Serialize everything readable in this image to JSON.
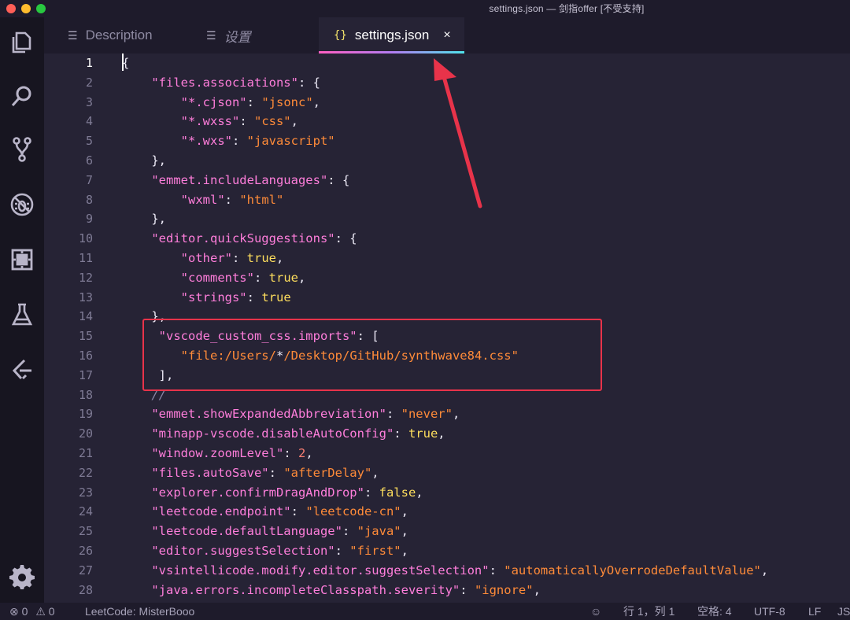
{
  "window": {
    "title": "settings.json — 剑指offer [不受支持]",
    "traffic_colors": [
      "#ff5f57",
      "#febc2e",
      "#28c840"
    ]
  },
  "activity_bar": {
    "items": [
      "files-icon",
      "search-icon",
      "source-control-icon",
      "debug-icon",
      "extensions-icon",
      "test-flask-icon",
      "leetcode-icon",
      "settings-gear-icon"
    ]
  },
  "tabs": [
    {
      "label": "Description",
      "icon": "preview-icon",
      "active": false
    },
    {
      "label": "设置",
      "icon": "preview-icon",
      "active": false
    },
    {
      "label": "settings.json",
      "icon": "{}",
      "active": true,
      "close": "×"
    }
  ],
  "editor": {
    "line_numbers": [
      "1",
      "2",
      "3",
      "4",
      "5",
      "6",
      "7",
      "8",
      "9",
      "10",
      "11",
      "12",
      "13",
      "14",
      "15",
      "16",
      "17",
      "18",
      "19",
      "20",
      "21",
      "22",
      "23",
      "24",
      "25",
      "26",
      "27",
      "28"
    ],
    "current_line": "1"
  },
  "status_bar": {
    "errors": "0",
    "warnings": "0",
    "leetcode": "LeetCode: MisterBooo",
    "position": "行 1，列 1",
    "spaces": "空格: 4",
    "encoding": "UTF-8",
    "eol": "LF",
    "language": "JS"
  },
  "colors": {
    "background": "#262335",
    "activity_bar": "#171520",
    "key": "#ff7edb",
    "string": "#ff8b39",
    "boolean": "#fede5d",
    "number": "#f97e72",
    "annotation": "#e8334a"
  }
}
